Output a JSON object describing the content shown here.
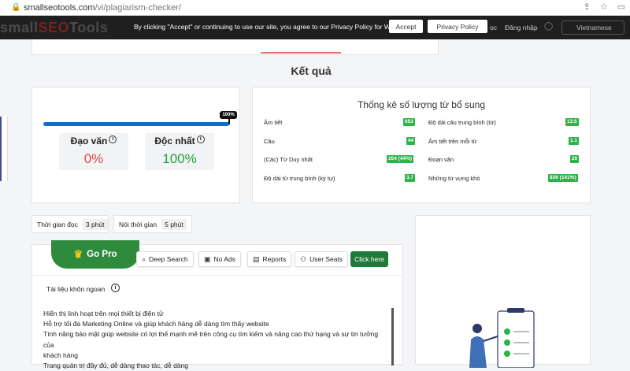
{
  "browser": {
    "url_host": "smallseotools.com",
    "url_path": "/vi/plagiarism-checker/"
  },
  "cookie": {
    "logo_small": "small",
    "logo_seo": "SEO",
    "logo_tools": "Tools",
    "message": "By clicking \"Accept\" or continuing to use our site, you agree to our Privacy Policy for Website",
    "accept_label": "Accept",
    "privacy_label": "Privacy Policy",
    "nav_partial": "ọc",
    "login": "Đăng nhập",
    "language": "Vietnamese"
  },
  "results": {
    "heading": "Kết quả",
    "progress_label": "100%",
    "progress_fraction": 1.0,
    "plagiarism_label": "Đạo văn",
    "plagiarism_value": "0%",
    "unique_label": "Độc nhất",
    "unique_value": "100%"
  },
  "stats": {
    "title": "Thống kê số lượng từ bổ sung",
    "left": [
      {
        "label": "Âm tiết",
        "value": "653"
      },
      {
        "label": "Câu",
        "value": "44"
      },
      {
        "label": "(Các) Từ Duy nhất",
        "value": "264 (44%)"
      },
      {
        "label": "Độ dài từ trung bình (ký tự)",
        "value": "3.7"
      }
    ],
    "right": [
      {
        "label": "Độ dài câu trung bình (từ)",
        "value": "13.5"
      },
      {
        "label": "Âm tiết trên mỗi từ",
        "value": "1.1"
      },
      {
        "label": "Đoạn văn",
        "value": "20"
      },
      {
        "label": "Những từ vựng khó",
        "value": "836 (141%)"
      }
    ]
  },
  "times": {
    "read_label": "Thời gian đọc",
    "read_value": "3 phút",
    "speak_label": "Nói thời gian",
    "speak_value": "5 phút"
  },
  "toolbar": {
    "gopro": "Go Pro",
    "deep_search": "Deep Search",
    "no_ads": "No Ads",
    "reports": "Reports",
    "user_seats": "User Seats",
    "click_here": "Click here"
  },
  "document": {
    "section_title": "Tài liệu khôn ngoan",
    "lines": [
      "Hiển thị linh hoạt trên mọi thiết bị điện tử",
      "Hỗ trợ tối đa Marketing Online và giúp khách hàng dễ dàng tìm thấy website",
      "Tính năng bảo mật giúp website có lợi thế mạnh mẽ trên công cụ tìm kiếm và nâng cao thứ hạng và sự tin tưởng của",
      "khách hàng",
      "Trang quản trị đầy đủ, dễ dàng thao tác, dễ dàng"
    ]
  },
  "colors": {
    "accent_green": "#2bb44a",
    "brand_green": "#2e8b3e",
    "progress_blue": "#0d6ed1",
    "plagiarism_red": "#e14848"
  }
}
